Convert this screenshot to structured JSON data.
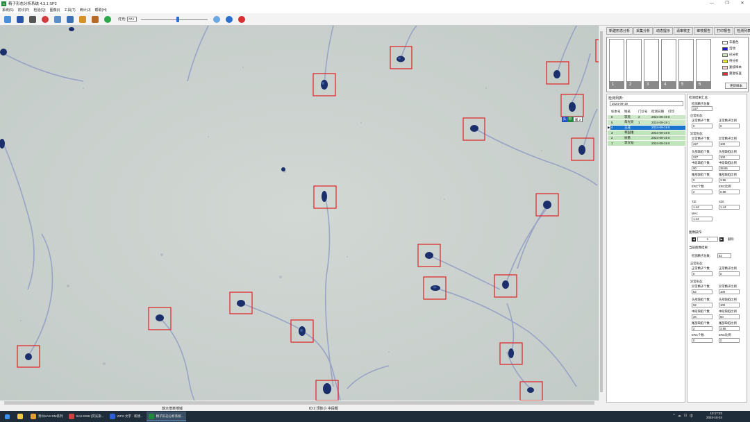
{
  "window": {
    "title": "精子形态分析系统 4.3.1 SP2",
    "icon_name": "app-logo-icon",
    "controls": [
      "minimize-icon",
      "maximize-icon",
      "close-icon"
    ]
  },
  "menu": [
    "系统(S)",
    "初诊(P)",
    "检验(Q)",
    "图像(I)",
    "工具(T)",
    "统计(J)",
    "帮助(H)"
  ],
  "toolbar": {
    "icons": [
      "new-icon",
      "save-icon",
      "print-icon",
      "palette-icon",
      "zoom-icon",
      "analyze-icon",
      "brush-icon",
      "play-icon"
    ],
    "light_label": "灯光:",
    "light_value": "074",
    "slider_level": 0.55,
    "extra_icons": [
      "capture-icon",
      "help-icon",
      "power-icon"
    ]
  },
  "status_bar": {
    "left_text": "放大倍率地域",
    "center_text": "ID:2 顶体小 中段粗"
  },
  "badge": {
    "b1": "头",
    "b2": "中",
    "b3": "尾 3"
  },
  "tabs": [
    "新建形态分析",
    "采集分析",
    "动态提示",
    "请审核正",
    "审核报告",
    "打印报告",
    "检测列表"
  ],
  "slots": [
    {
      "num": "1"
    },
    {
      "num": "2"
    },
    {
      "num": "3"
    },
    {
      "num": "4"
    },
    {
      "num": "5"
    },
    {
      "num": "6"
    }
  ],
  "legend": [
    {
      "label": "未着色",
      "color": "#ffffff"
    },
    {
      "label": "活动",
      "color": "#1b1bd6"
    },
    {
      "label": "已分析",
      "color": "#cfe8b8"
    },
    {
      "label": "待分析",
      "color": "#f2f028"
    },
    {
      "label": "复核样本",
      "color": "#ffd0d0"
    },
    {
      "label": "重复核查",
      "color": "#e03030"
    }
  ],
  "refresh_label": "更新样本",
  "list": {
    "title": "检测列表:",
    "date": "2024-09-19",
    "headers": [
      "标本号",
      "姓名",
      "门诊号",
      "检测日期",
      "打印"
    ],
    "rows": [
      {
        "id": "8",
        "name": "李英",
        "clinic": "2",
        "date": "2024-09-19",
        "print": "0",
        "style": "g"
      },
      {
        "id": "5",
        "name": "朱光亮",
        "clinic": "1",
        "date": "2024-09-19",
        "print": "1",
        "style": "g"
      },
      {
        "id": "4",
        "name": "王成",
        "clinic": "",
        "date": "2024-09-19",
        "print": "0",
        "style": "sel"
      },
      {
        "id": "3",
        "name": "蒋国维",
        "clinic": "",
        "date": "2024-09-19",
        "print": "0",
        "style": "g2"
      },
      {
        "id": "2",
        "name": "徐勇",
        "clinic": "",
        "date": "2024-09-19",
        "print": "0",
        "style": "g2"
      },
      {
        "id": "1",
        "name": "李文韬",
        "clinic": "",
        "date": "2024-09-19",
        "print": "0",
        "style": "g2"
      }
    ]
  },
  "summary": {
    "title": "检测结果汇总:",
    "total_label": "检测精子总数",
    "total": "227",
    "normal_section": "正常形态:",
    "normal_count_label": "正常精子个数",
    "normal_count": "0",
    "normal_ratio_label": "正常精子比例",
    "normal_ratio": "0",
    "abnormal_section": "异常形态:",
    "abnormal_count_label": "异常精子个数",
    "abnormal_count": "227",
    "abnormal_ratio_label": "异常精子比例",
    "abnormal_ratio": "100",
    "head_count_label": "头部缺陷个数",
    "head_count": "227",
    "head_ratio_label": "头部缺陷比例",
    "head_ratio": "100",
    "mid_count_label": "中段缺陷个数",
    "mid_count": "90",
    "mid_ratio_label": "中段缺陷比例",
    "mid_ratio": "39.65",
    "tail_count_label": "尾部缺陷个数",
    "tail_count": "9",
    "tail_ratio_label": "尾部缺陷比例",
    "tail_ratio": "3.96",
    "erc_count_label": "ERC个数",
    "erc_count": "2",
    "erc_ratio_label": "ERC比例",
    "erc_ratio": "0.88",
    "tzi_label": "TZI:",
    "tzi": "1.44",
    "sdi_label": "SDI:",
    "sdi": "1.44",
    "mai_label": "MAI:",
    "mai": "1.44"
  },
  "image_nav": {
    "title": "图像操作:",
    "value": "1",
    "delete_label": "删除"
  },
  "current": {
    "title": "当前图像结果:",
    "total_label": "检测精子总数:",
    "total": "52",
    "normal_section": "正常形态:",
    "normal_count_label": "正常精子个数",
    "normal_count": "0",
    "normal_ratio_label": "正常精子比例",
    "normal_ratio": "0",
    "abnormal_section": "异常形态:",
    "abnormal_count_label": "异常精子个数",
    "abnormal_count": "52",
    "abnormal_ratio_label": "异常精子比例",
    "abnormal_ratio": "100",
    "head_count_label": "头部缺陷个数",
    "head_count": "52",
    "head_ratio_label": "头部缺陷比例",
    "head_ratio": "100",
    "mid_count_label": "中段缺陷个数",
    "mid_count": "26",
    "mid_ratio_label": "中段缺陷比例",
    "mid_ratio": "50",
    "tail_count_label": "尾部缺陷个数",
    "tail_count": "2",
    "tail_ratio_label": "尾部缺陷比例",
    "tail_ratio": "3.85",
    "erc_count_label": "ERC个数",
    "erc_count": "0",
    "erc_ratio_label": "ERC比例",
    "erc_ratio": "0"
  },
  "taskbar": {
    "items": [
      {
        "label": "贵州SAS-DM系列",
        "color": "#e0a030"
      },
      {
        "label": "SAS-DM6 (荧光染...",
        "color": "#d04040"
      },
      {
        "label": "WPS 文字 - 新建...",
        "color": "#2a5fd8"
      },
      {
        "label": "精子形态分析系统...",
        "color": "#1f8a3a"
      }
    ],
    "tray": [
      "^",
      "☁",
      "⊡",
      "中"
    ],
    "time": "13:17:23",
    "date": "2024-10-24"
  }
}
